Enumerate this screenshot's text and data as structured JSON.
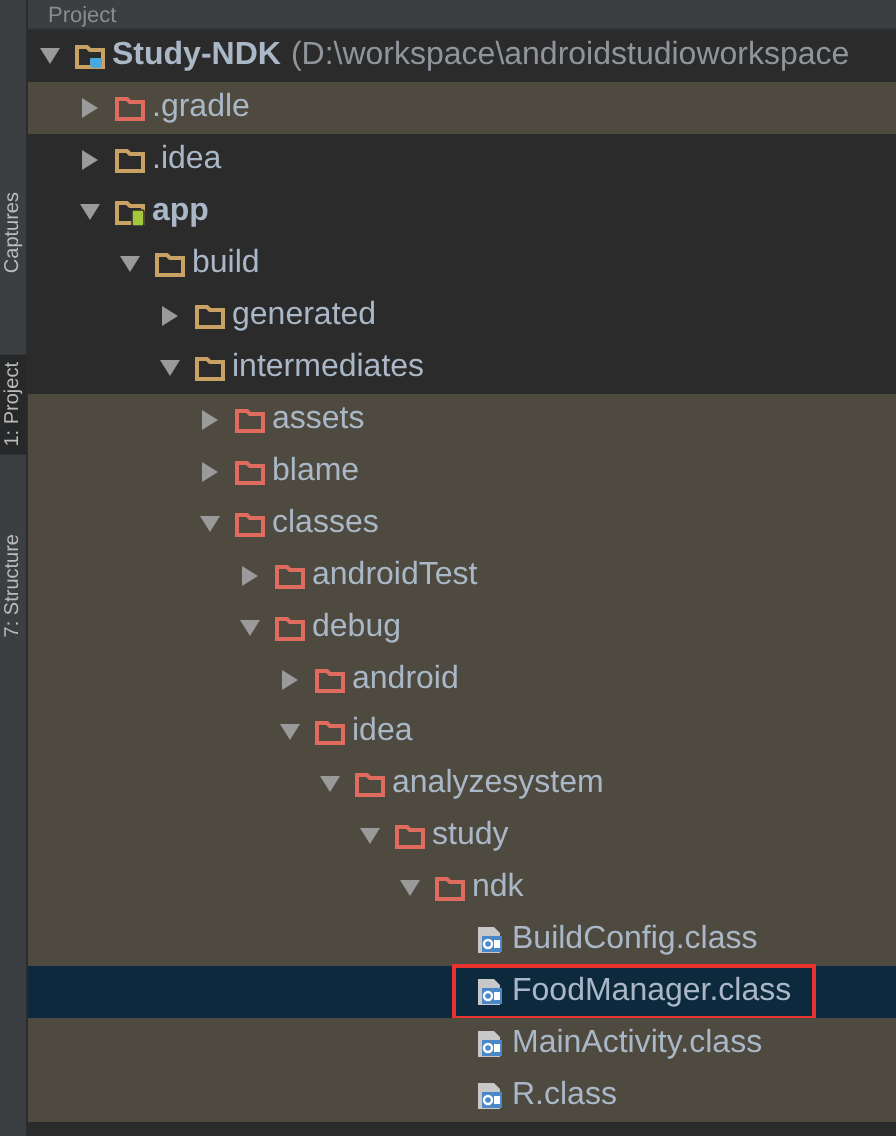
{
  "side_tabs": [
    {
      "label": "Captures",
      "selected": false
    },
    {
      "label": "1: Project",
      "selected": true
    },
    {
      "label": "7: Structure",
      "selected": false
    }
  ],
  "panel": {
    "title": "Project"
  },
  "tree": [
    {
      "name": "Study-NDK",
      "path": "(D:\\workspace\\androidstudioworkspace",
      "kind": "project",
      "expanded": true,
      "excluded": false,
      "selected": false,
      "annotated": false,
      "children": [
        {
          "name": ".gradle",
          "kind": "folder",
          "expanded": false,
          "excluded": true,
          "selected": false,
          "annotated": false
        },
        {
          "name": ".idea",
          "kind": "folder",
          "expanded": false,
          "excluded": false,
          "selected": false,
          "annotated": false
        },
        {
          "name": "app",
          "kind": "module",
          "expanded": true,
          "excluded": false,
          "selected": false,
          "annotated": false,
          "children": [
            {
              "name": "build",
              "kind": "folder",
              "expanded": true,
              "excluded": false,
              "selected": false,
              "annotated": false,
              "children": [
                {
                  "name": "generated",
                  "kind": "folder",
                  "expanded": false,
                  "excluded": false,
                  "selected": false,
                  "annotated": false
                },
                {
                  "name": "intermediates",
                  "kind": "folder",
                  "expanded": true,
                  "excluded": false,
                  "selected": false,
                  "annotated": false,
                  "children": [
                    {
                      "name": "assets",
                      "kind": "folder",
                      "expanded": false,
                      "excluded": true,
                      "selected": false,
                      "annotated": false
                    },
                    {
                      "name": "blame",
                      "kind": "folder",
                      "expanded": false,
                      "excluded": true,
                      "selected": false,
                      "annotated": false
                    },
                    {
                      "name": "classes",
                      "kind": "folder",
                      "expanded": true,
                      "excluded": true,
                      "selected": false,
                      "annotated": false,
                      "children": [
                        {
                          "name": "androidTest",
                          "kind": "folder",
                          "expanded": false,
                          "excluded": true,
                          "selected": false,
                          "annotated": false
                        },
                        {
                          "name": "debug",
                          "kind": "folder",
                          "expanded": true,
                          "excluded": true,
                          "selected": false,
                          "annotated": false,
                          "children": [
                            {
                              "name": "android",
                              "kind": "folder",
                              "expanded": false,
                              "excluded": true,
                              "selected": false,
                              "annotated": false
                            },
                            {
                              "name": "idea",
                              "kind": "folder",
                              "expanded": true,
                              "excluded": true,
                              "selected": false,
                              "annotated": false,
                              "children": [
                                {
                                  "name": "analyzesystem",
                                  "kind": "folder",
                                  "expanded": true,
                                  "excluded": true,
                                  "selected": false,
                                  "annotated": false,
                                  "children": [
                                    {
                                      "name": "study",
                                      "kind": "folder",
                                      "expanded": true,
                                      "excluded": true,
                                      "selected": false,
                                      "annotated": false,
                                      "children": [
                                        {
                                          "name": "ndk",
                                          "kind": "folder",
                                          "expanded": true,
                                          "excluded": true,
                                          "selected": false,
                                          "annotated": false,
                                          "children": [
                                            {
                                              "name": "BuildConfig.class",
                                              "kind": "class",
                                              "excluded": true,
                                              "selected": false,
                                              "annotated": false
                                            },
                                            {
                                              "name": "FoodManager.class",
                                              "kind": "class",
                                              "excluded": true,
                                              "selected": true,
                                              "annotated": true
                                            },
                                            {
                                              "name": "MainActivity.class",
                                              "kind": "class",
                                              "excluded": true,
                                              "selected": false,
                                              "annotated": false
                                            },
                                            {
                                              "name": "R.class",
                                              "kind": "class",
                                              "excluded": true,
                                              "selected": false,
                                              "annotated": false
                                            }
                                          ]
                                        }
                                      ]
                                    }
                                  ]
                                }
                              ]
                            }
                          ]
                        }
                      ]
                    }
                  ]
                }
              ]
            }
          ]
        }
      ]
    }
  ]
}
